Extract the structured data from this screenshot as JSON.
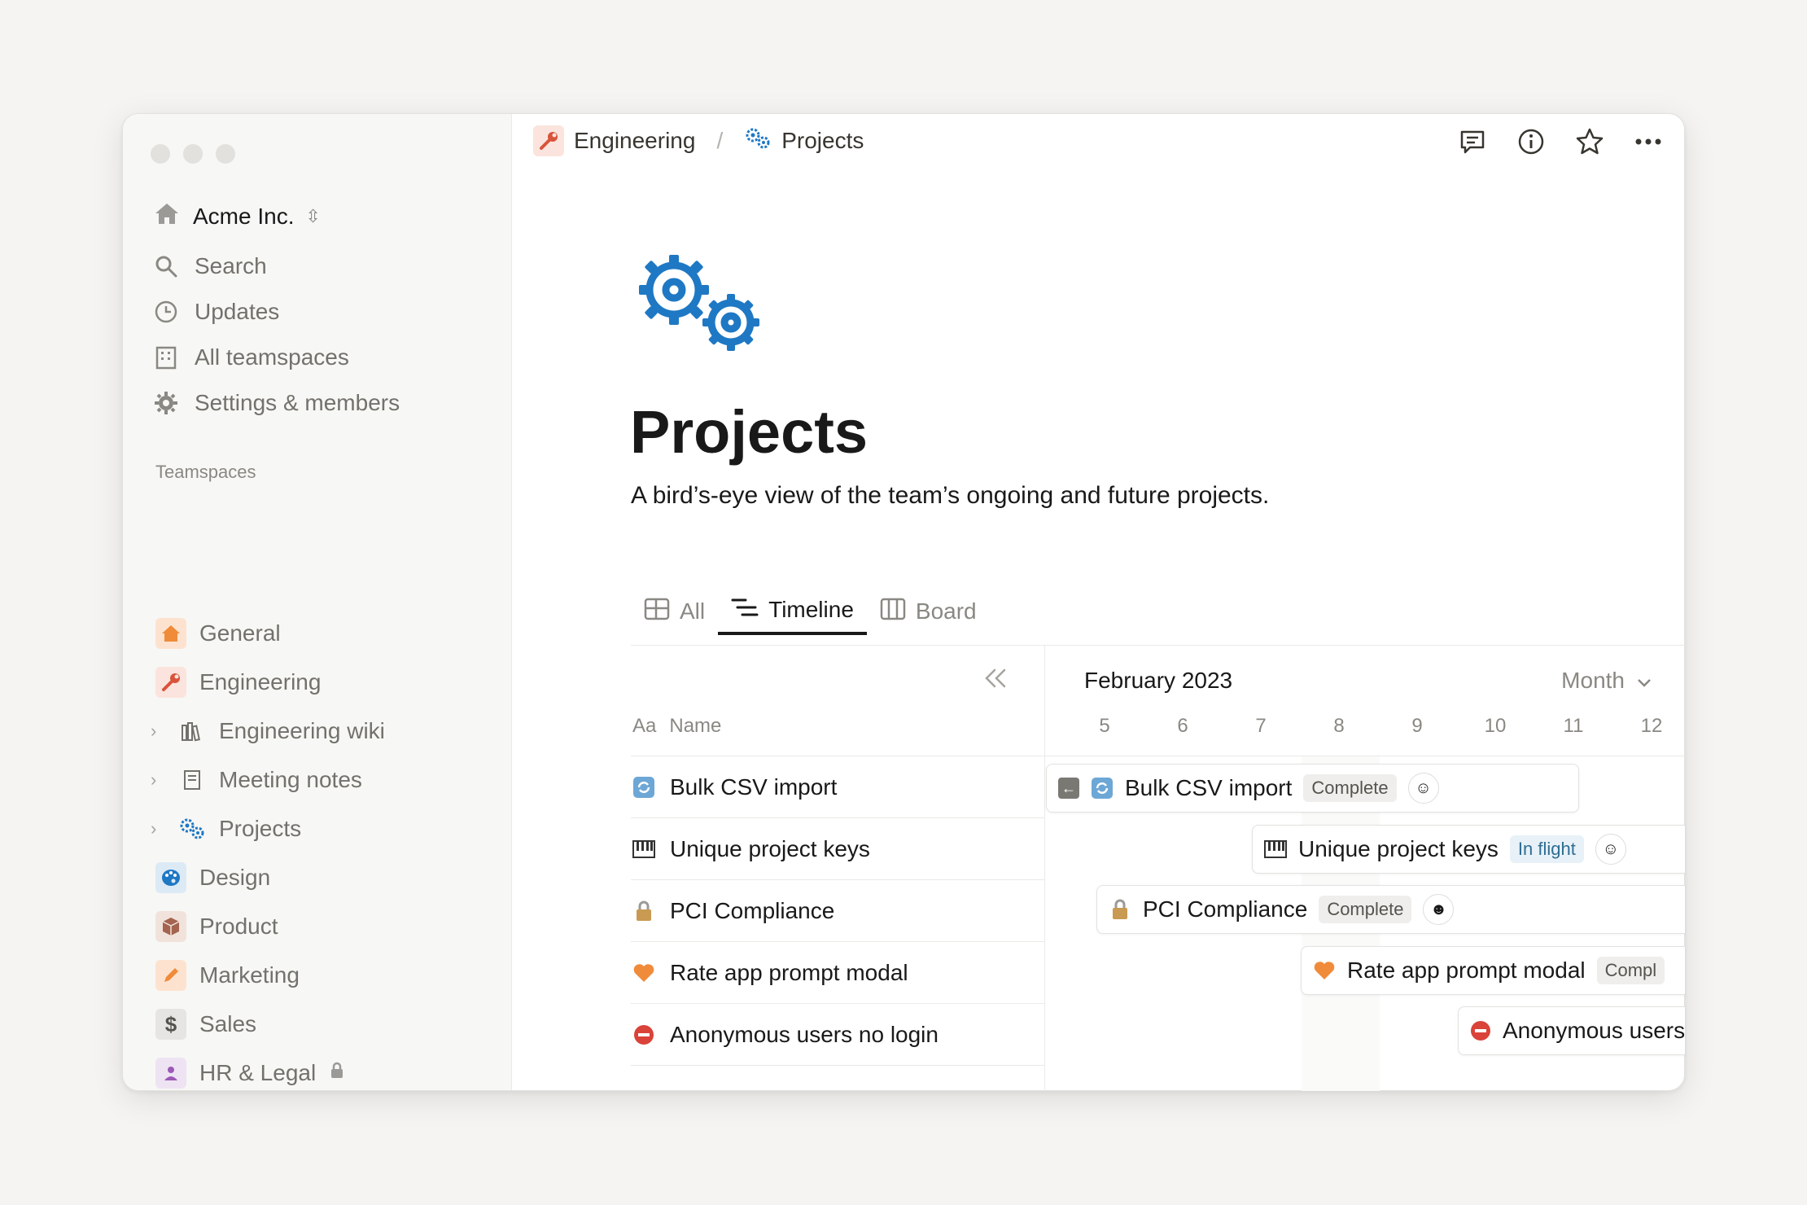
{
  "sidebar": {
    "workspace": "Acme Inc.",
    "nav": [
      {
        "label": "Search",
        "icon": "search-icon"
      },
      {
        "label": "Updates",
        "icon": "clock-icon"
      },
      {
        "label": "All teamspaces",
        "icon": "building-icon"
      },
      {
        "label": "Settings & members",
        "icon": "gear-icon"
      }
    ],
    "teamspaces_heading": "Teamspaces",
    "teamspaces": [
      {
        "label": "General",
        "icon": "house-icon"
      },
      {
        "label": "Engineering",
        "icon": "wrench-icon"
      },
      {
        "label": "Engineering wiki",
        "icon": "books-icon"
      },
      {
        "label": "Meeting notes",
        "icon": "notebook-icon"
      },
      {
        "label": "Projects",
        "icon": "gears-icon"
      },
      {
        "label": "Design",
        "icon": "palette-icon"
      },
      {
        "label": "Product",
        "icon": "box-icon"
      },
      {
        "label": "Marketing",
        "icon": "pencil-icon"
      },
      {
        "label": "Sales",
        "icon": "dollar-icon"
      },
      {
        "label": "HR & Legal",
        "icon": "person-icon"
      }
    ]
  },
  "breadcrumb": {
    "parent": "Engineering",
    "separator": "/",
    "current": "Projects"
  },
  "page": {
    "title": "Projects",
    "description": "A bird’s-eye view of the team’s ongoing and future projects."
  },
  "views": [
    {
      "label": "All",
      "icon": "table-icon"
    },
    {
      "label": "Timeline",
      "icon": "timeline-icon"
    },
    {
      "label": "Board",
      "icon": "board-icon"
    }
  ],
  "table": {
    "col_prefix": "Aa",
    "col_name": "Name",
    "rows": [
      {
        "name": "Bulk CSV import",
        "emoji": "🔄"
      },
      {
        "name": "Unique project keys",
        "emoji": "🎹"
      },
      {
        "name": "PCI Compliance",
        "emoji": "🔒"
      },
      {
        "name": "Rate app prompt modal",
        "emoji": "🧡"
      },
      {
        "name": "Anonymous users no login",
        "emoji": "⛔"
      }
    ]
  },
  "timeline": {
    "month": "February 2023",
    "scale": "Month",
    "days": [
      "5",
      "6",
      "7",
      "8",
      "9",
      "10",
      "11",
      "12"
    ],
    "items": [
      {
        "name": "Bulk CSV import",
        "status": "Complete",
        "emoji": "🔄"
      },
      {
        "name": "Unique project keys",
        "status": "In flight",
        "emoji": "🎹"
      },
      {
        "name": "PCI Compliance",
        "status": "Complete",
        "emoji": "🔒"
      },
      {
        "name": "Rate app prompt modal",
        "status": "Compl",
        "emoji": "🧡"
      },
      {
        "name": "Anonymous users",
        "status": "",
        "emoji": "⛔"
      }
    ]
  },
  "colors": {
    "accent_blue": "#1f78c4",
    "sidebar_bg": "#f7f7f5",
    "text": "#191919",
    "muted": "#8a8883"
  }
}
